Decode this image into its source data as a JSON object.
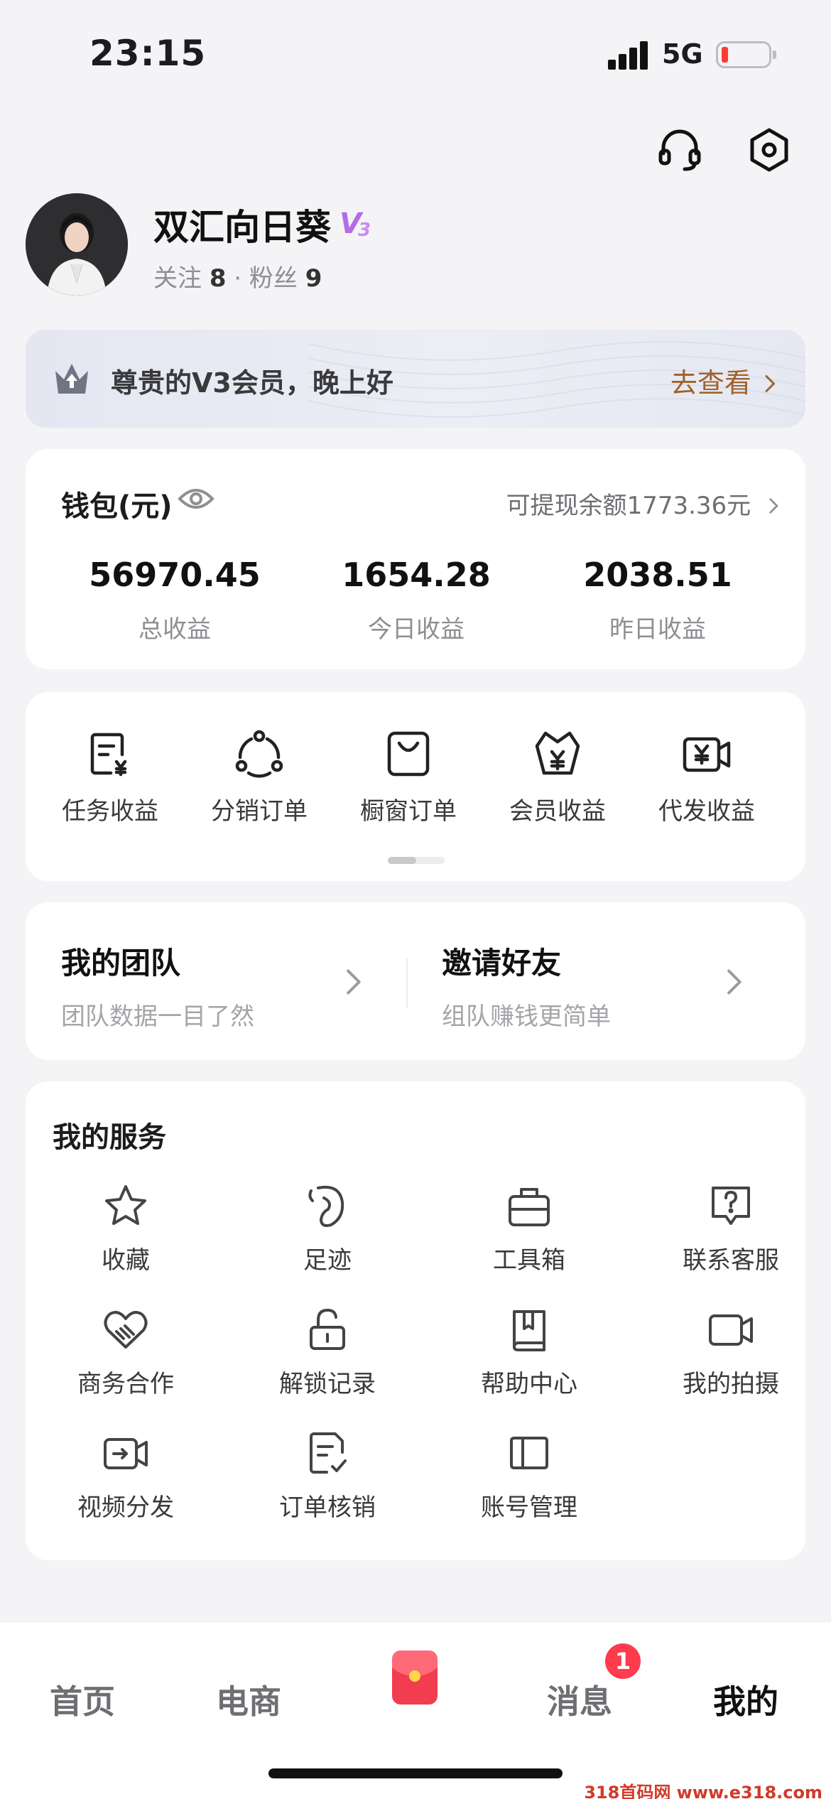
{
  "status_bar": {
    "time": "23:15",
    "network": "5G",
    "battery_color": "#ff3b30"
  },
  "top_icons": [
    {
      "name": "headset-icon"
    },
    {
      "name": "settings-hexagon-icon"
    }
  ],
  "profile": {
    "name": "双汇向日葵",
    "vip_level": "V3",
    "follow_label": "关注",
    "follow_count": "8",
    "separator": "·",
    "fans_label": "粉丝",
    "fans_count": "9"
  },
  "member_banner": {
    "text": "尊贵的V3会员，晚上好",
    "link": "去查看"
  },
  "wallet": {
    "title": "钱包(元)",
    "withdrawable": "可提现余额1773.36元",
    "stats": [
      {
        "value": "56970.45",
        "label": "总收益"
      },
      {
        "value": "1654.28",
        "label": "今日收益"
      },
      {
        "value": "2038.51",
        "label": "昨日收益"
      }
    ]
  },
  "quick_entries": [
    {
      "label": "任务收益",
      "icon": "task-income-icon"
    },
    {
      "label": "分销订单",
      "icon": "distribution-icon"
    },
    {
      "label": "橱窗订单",
      "icon": "shopping-bag-icon"
    },
    {
      "label": "会员收益",
      "icon": "member-income-icon"
    },
    {
      "label": "代发收益",
      "icon": "video-yuan-icon"
    }
  ],
  "team": {
    "my_team": {
      "title": "我的团队",
      "subtitle": "团队数据一目了然"
    },
    "invite": {
      "title": "邀请好友",
      "subtitle": "组队赚钱更简单"
    }
  },
  "services": {
    "title": "我的服务",
    "items": [
      {
        "label": "收藏",
        "icon": "star-icon"
      },
      {
        "label": "足迹",
        "icon": "footprint-icon"
      },
      {
        "label": "工具箱",
        "icon": "toolbox-icon"
      },
      {
        "label": "联系客服",
        "icon": "help-chat-icon"
      },
      {
        "label": "商务合作",
        "icon": "handshake-heart-icon"
      },
      {
        "label": "解锁记录",
        "icon": "unlock-icon"
      },
      {
        "label": "帮助中心",
        "icon": "book-icon"
      },
      {
        "label": "我的拍摄",
        "icon": "camera-icon"
      },
      {
        "label": "视频分发",
        "icon": "video-share-icon"
      },
      {
        "label": "订单核销",
        "icon": "order-check-icon"
      },
      {
        "label": "账号管理",
        "icon": "account-card-icon"
      }
    ]
  },
  "bottom_nav": {
    "items": [
      {
        "label": "首页"
      },
      {
        "label": "电商"
      },
      {
        "label": "消息"
      },
      {
        "label": "我的"
      }
    ],
    "message_badge": "1",
    "active": "我的"
  },
  "watermark": "318首码网 www.e318.com",
  "colors": {
    "accent_brown": "#a0622a",
    "badge_red": "#ff3b4d",
    "vip_purple": "#b36be6"
  }
}
